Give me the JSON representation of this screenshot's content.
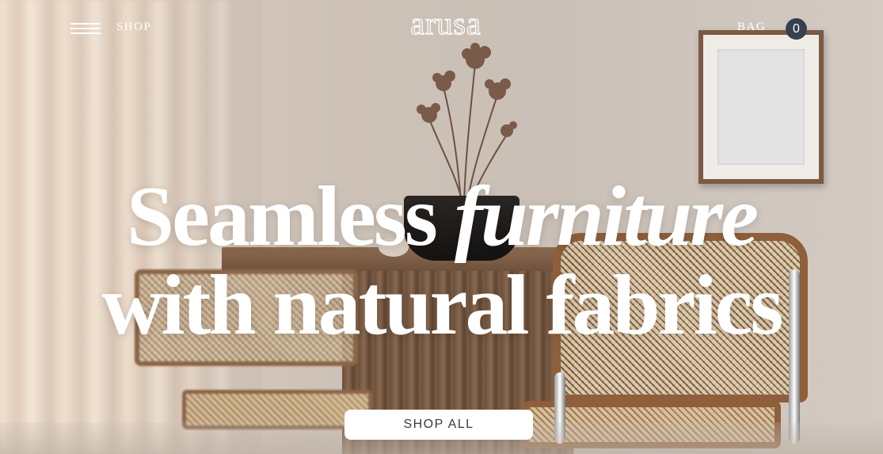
{
  "header": {
    "menu_icon": "hamburger-menu-icon",
    "shop_label": "SHOP",
    "logo_text": "arusa",
    "bag_label": "BAG",
    "bag_count": "0"
  },
  "hero": {
    "headline_word1": "Seamless",
    "headline_word2": "furniture",
    "headline_line2": "with natural fabrics",
    "cta_label": "SHOP ALL"
  },
  "colors": {
    "text": "#ffffff",
    "bag_badge": "#36404f",
    "cta_background": "#ffffff",
    "cta_text": "#3a3a3a"
  }
}
